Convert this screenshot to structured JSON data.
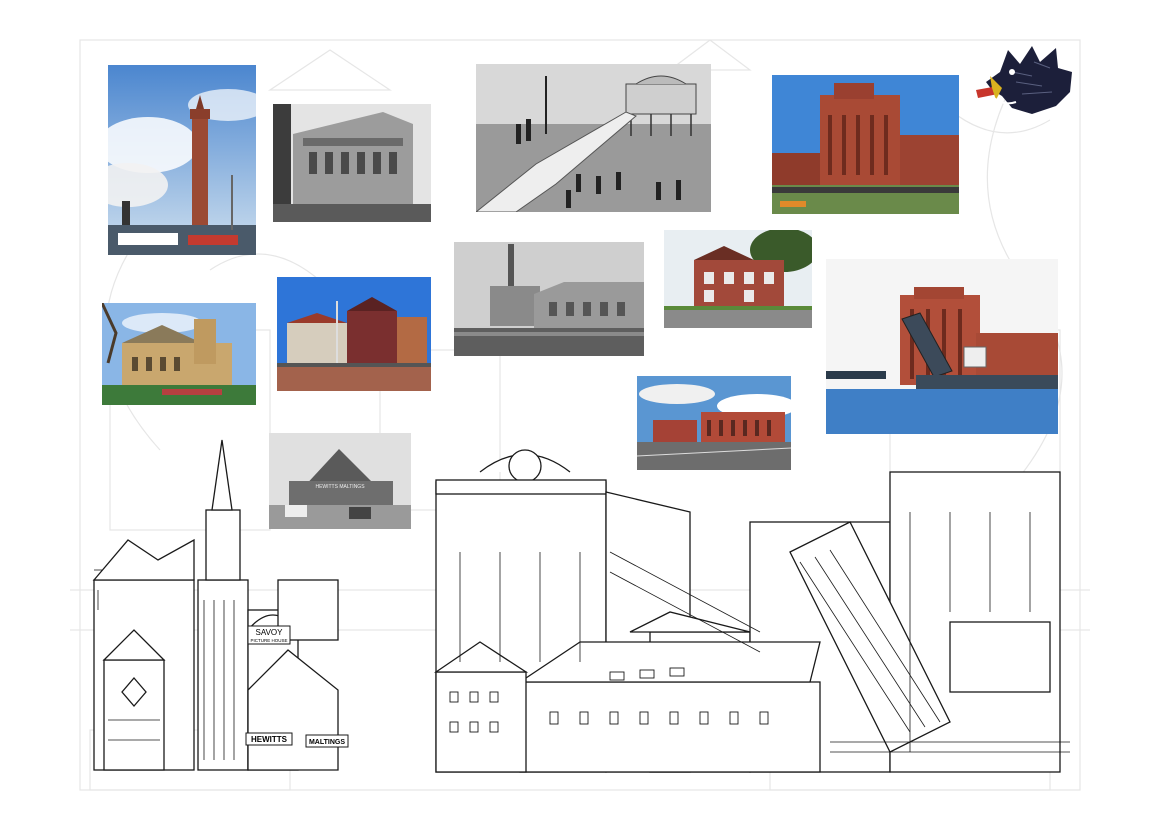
{
  "sketch": {
    "savoy_sign": "SAVOY",
    "savoy_sign_sub": "PICTURE HOUSE",
    "hewitts_sign": "HEWITTS",
    "maltings_sign": "MALTINGS"
  },
  "photos": {
    "maltings_sign": "HEWITTS MALTINGS"
  },
  "colors": {
    "brick": "#9b4a34",
    "sky": "#4a8fd6",
    "water": "#3f7fc6",
    "ink": "#1a1a1a",
    "boar_black": "#1c1f3a",
    "boar_gold": "#d9b21f",
    "boar_red": "#c8352b"
  },
  "icons": [
    "boar-head-crest-icon"
  ]
}
